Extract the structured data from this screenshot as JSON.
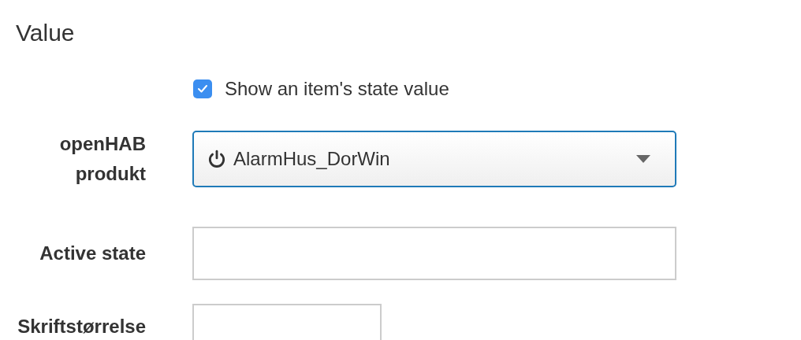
{
  "heading": "Value",
  "show_state": {
    "label": "Show an item's state value",
    "checked": true
  },
  "fields": [
    {
      "kind": "select",
      "label": "openHAB produkt",
      "value": "AlarmHus_DorWin"
    },
    {
      "kind": "text",
      "label": "Active state"
    },
    {
      "kind": "short",
      "label": "Skriftstørrelse"
    }
  ]
}
